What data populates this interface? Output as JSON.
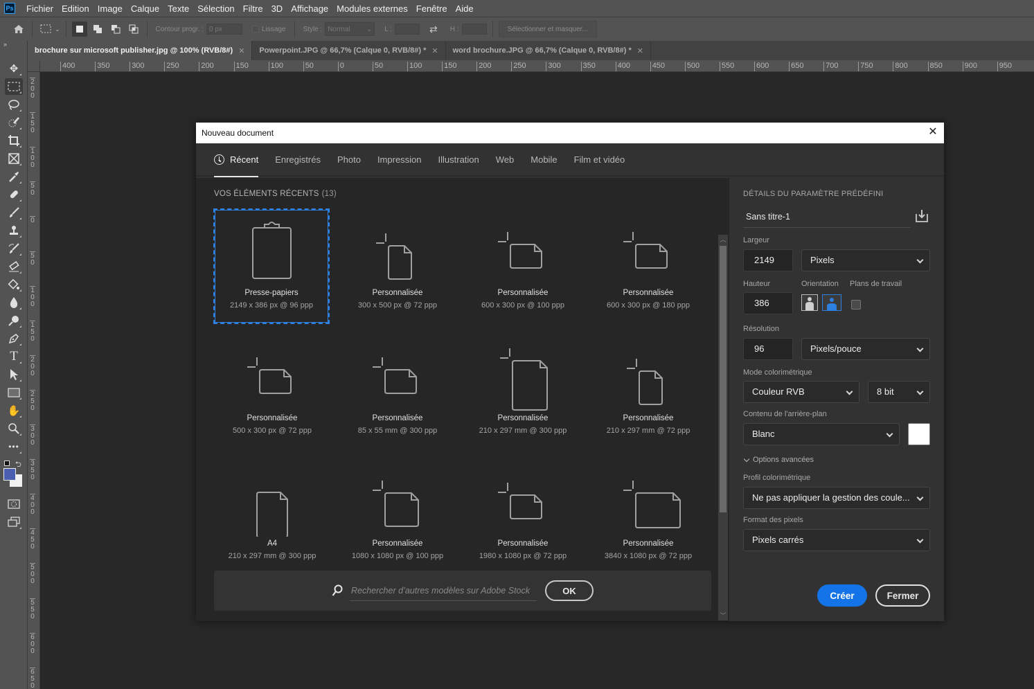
{
  "app": {
    "logo": "Ps",
    "menu": [
      "Fichier",
      "Edition",
      "Image",
      "Calque",
      "Texte",
      "Sélection",
      "Filtre",
      "3D",
      "Affichage",
      "Modules externes",
      "Fenêtre",
      "Aide"
    ]
  },
  "options_bar": {
    "feather_label": "Contour progr. :",
    "feather_value": "0 px",
    "antialias_label": "Lissage",
    "style_label": "Style :",
    "style_value": "Normal",
    "width_label": "L :",
    "height_label": "H :",
    "select_mask_label": "Sélectionner et masquer..."
  },
  "doc_tabs": [
    {
      "label": "brochure sur microsoft publisher.jpg @ 100% (RVB/8#)",
      "active": true
    },
    {
      "label": "Powerpoint.JPG @ 66,7% (Calque 0, RVB/8#) *",
      "active": false
    },
    {
      "label": "word brochure.JPG @ 66,7% (Calque 0, RVB/8#) *",
      "active": false
    }
  ],
  "rulers": {
    "horizontal": [
      "400",
      "350",
      "300",
      "250",
      "200",
      "150",
      "100",
      "50",
      "0",
      "50",
      "100",
      "150",
      "200",
      "250",
      "300",
      "350",
      "400",
      "450",
      "500",
      "550",
      "600",
      "650",
      "700",
      "750",
      "800",
      "850",
      "900",
      "950"
    ],
    "vertical": [
      "200",
      "150",
      "100",
      "50",
      "0",
      "50",
      "100",
      "150",
      "200",
      "250",
      "300",
      "350",
      "400",
      "450",
      "500",
      "550",
      "600",
      "650"
    ]
  },
  "colors": {
    "foreground": "#4a5fb0",
    "background": "#f2f2f2",
    "accent": "#1473e6",
    "selection": "#2d7fe0"
  },
  "dialog": {
    "title": "Nouveau document",
    "close_glyph": "✕",
    "tabs": [
      {
        "label": "Récent",
        "active": true
      },
      {
        "label": "Enregistrés"
      },
      {
        "label": "Photo"
      },
      {
        "label": "Impression"
      },
      {
        "label": "Illustration"
      },
      {
        "label": "Web"
      },
      {
        "label": "Mobile"
      },
      {
        "label": "Film et vidéo"
      }
    ],
    "recent": {
      "heading": "VOS ÉLÉMENTS RÉCENTS",
      "count": "(13)",
      "items": [
        {
          "name": "Presse-papiers",
          "dims": "2149 x 386 px @ 96 ppp",
          "icon": "clipboard",
          "selected": true
        },
        {
          "name": "Personnalisée",
          "dims": "300 x 500 px @ 72 ppp",
          "icon": "portrait-small"
        },
        {
          "name": "Personnalisée",
          "dims": "600 x 300 px @ 100 ppp",
          "icon": "landscape"
        },
        {
          "name": "Personnalisée",
          "dims": "600 x 300 px @ 180 ppp",
          "icon": "landscape"
        },
        {
          "name": "Personnalisée",
          "dims": "500 x 300 px @ 72 ppp",
          "icon": "landscape"
        },
        {
          "name": "Personnalisée",
          "dims": "85 x 55 mm @ 300 ppp",
          "icon": "landscape"
        },
        {
          "name": "Personnalisée",
          "dims": "210 x 297 mm @ 300 ppp",
          "icon": "portrait-large"
        },
        {
          "name": "Personnalisée",
          "dims": "210 x 297 mm @ 72 ppp",
          "icon": "portrait-small"
        },
        {
          "name": "A4",
          "dims": "210 x 297 mm @ 300 ppp",
          "icon": "page"
        },
        {
          "name": "Personnalisée",
          "dims": "1080 x 1080 px @ 100 ppp",
          "icon": "square"
        },
        {
          "name": "Personnalisée",
          "dims": "1980 x 1080 px @ 72 ppp",
          "icon": "landscape"
        },
        {
          "name": "Personnalisée",
          "dims": "3840 x 1080 px @ 72 ppp",
          "icon": "landscape-wide"
        }
      ]
    },
    "search": {
      "placeholder": "Rechercher d’autres modèles sur Adobe Stock",
      "ok_label": "OK"
    },
    "details": {
      "heading": "DÉTAILS DU PARAMÈTRE PRÉDÉFINI",
      "preset_name": "Sans titre-1",
      "width_label": "Largeur",
      "width_value": "2149",
      "width_unit": "Pixels",
      "height_label": "Hauteur",
      "height_value": "386",
      "orientation_label": "Orientation",
      "orientation_selected": "paysage",
      "artboards_label": "Plans de travail",
      "artboards_checked": false,
      "resolution_label": "Résolution",
      "resolution_value": "96",
      "resolution_unit": "Pixels/pouce",
      "color_mode_label": "Mode colorimétrique",
      "color_mode_value": "Couleur RVB",
      "bit_depth_value": "8 bit",
      "background_label": "Contenu de l'arrière-plan",
      "background_value": "Blanc",
      "background_color": "#ffffff",
      "advanced_label": "Options avancées",
      "profile_label": "Profil colorimétrique",
      "profile_value": "Ne pas appliquer la gestion des coule...",
      "pixel_format_label": "Format des pixels",
      "pixel_format_value": "Pixels carrés",
      "create_label": "Créer",
      "close_label": "Fermer"
    }
  }
}
